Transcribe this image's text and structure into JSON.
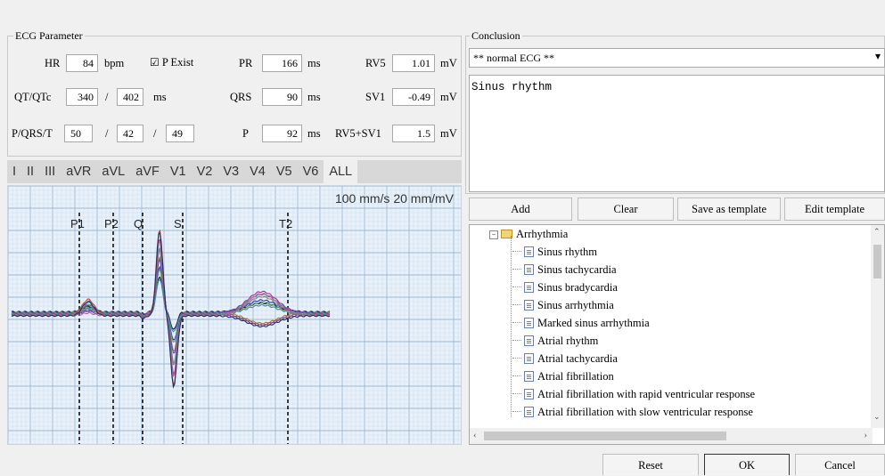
{
  "params": {
    "section_title": "ECG Parameter",
    "hr_label": "HR",
    "hr_value": "84",
    "hr_unit": "bpm",
    "p_exist_label": "P Exist",
    "p_exist_check": "☑",
    "pr_label": "PR",
    "pr_value": "166",
    "pr_unit": "ms",
    "rv5_label": "RV5",
    "rv5_value": "1.01",
    "rv5_unit": "mV",
    "qt_label": "QT/QTc",
    "qt_value": "340",
    "qt_sep": "/",
    "qtc_value": "402",
    "qt_unit": "ms",
    "qrs_label": "QRS",
    "qrs_value": "90",
    "qrs_unit": "ms",
    "sv1_label": "SV1",
    "sv1_value": "-0.49",
    "sv1_unit": "mV",
    "pqrst_label": "P/QRS/T",
    "p_axis": "50",
    "sep1": "/",
    "qrs_axis": "42",
    "sep2": "/",
    "t_axis": "49",
    "p_label": "P",
    "p_value": "92",
    "p_unit": "ms",
    "rvsv_label": "RV5+SV1",
    "rvsv_value": "1.5",
    "rvsv_unit": "mV"
  },
  "leads": [
    "I",
    "II",
    "III",
    "aVR",
    "aVL",
    "aVF",
    "V1",
    "V2",
    "V3",
    "V4",
    "V5",
    "V6",
    "ALL"
  ],
  "active_lead": "ALL",
  "ecg": {
    "scale_text": "100 mm/s 20 mm/mV",
    "markers": [
      "P1",
      "P2",
      "Q",
      "S",
      "T2"
    ],
    "trace_colors": [
      "#1a1a1a",
      "#3030c0",
      "#8a8a30",
      "#30a0a0",
      "#a030a0",
      "#c04040",
      "#4080c0",
      "#60a060",
      "#7040c0",
      "#808080",
      "#b06090",
      "#203060"
    ]
  },
  "conclusion": {
    "section_title": "Conclusion",
    "dropdown_value": "** normal ECG **",
    "text": "Sinus rhythm",
    "buttons": {
      "add": "Add",
      "clear": "Clear",
      "save_template": "Save as template",
      "edit_template": "Edit template"
    }
  },
  "tree": {
    "root": "Arrhythmia",
    "items": [
      "Sinus rhythm",
      "Sinus tachycardia",
      "Sinus bradycardia",
      "Sinus arrhythmia",
      "Marked sinus arrhythmia",
      "Atrial rhythm",
      "Atrial tachycardia",
      "Atrial fibrillation",
      "Atrial fibrillation with rapid ventricular response",
      "Atrial fibrillation with slow ventricular response"
    ]
  },
  "footer": {
    "reset": "Reset",
    "ok": "OK",
    "cancel": "Cancel"
  }
}
